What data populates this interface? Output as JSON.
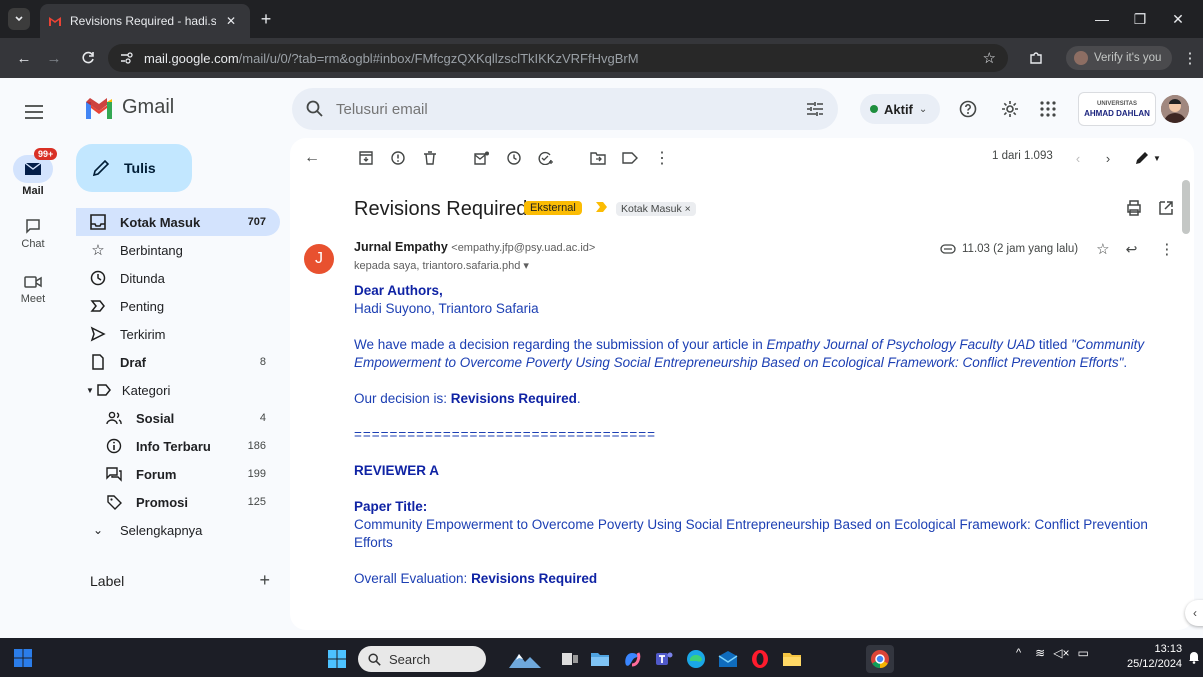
{
  "browser": {
    "tab_title": "Revisions Required - hadi.suyon",
    "url_host": "mail.google.com",
    "url_path": "/mail/u/0/?tab=rm&ogbl#inbox/FMfcgzQXKqllzsclTkIKKzVRFfHvgBrM",
    "verify_label": "Verify it's you"
  },
  "gmail": {
    "logo_text": "Gmail",
    "search_placeholder": "Telusuri email",
    "status_label": "Aktif",
    "org_line1": "UNIVERSITAS",
    "org_line2": "AHMAD DAHLAN"
  },
  "rail": {
    "mail_label": "Mail",
    "mail_badge": "99+",
    "chat_label": "Chat",
    "meet_label": "Meet"
  },
  "compose_label": "Tulis",
  "nav": [
    {
      "label": "Kotak Masuk",
      "count": "707",
      "icon": "inbox-icon"
    },
    {
      "label": "Berbintang",
      "count": "",
      "icon": "star-icon"
    },
    {
      "label": "Ditunda",
      "count": "",
      "icon": "clock-icon"
    },
    {
      "label": "Penting",
      "count": "",
      "icon": "important-icon"
    },
    {
      "label": "Terkirim",
      "count": "",
      "icon": "send-icon"
    },
    {
      "label": "Draf",
      "count": "8",
      "icon": "draft-icon"
    },
    {
      "label": "Kategori",
      "count": "",
      "icon": "label-icon"
    },
    {
      "label": "Sosial",
      "count": "4",
      "icon": "people-icon"
    },
    {
      "label": "Info Terbaru",
      "count": "186",
      "icon": "info-icon"
    },
    {
      "label": "Forum",
      "count": "199",
      "icon": "forum-icon"
    },
    {
      "label": "Promosi",
      "count": "125",
      "icon": "tag-icon"
    },
    {
      "label": "Selengkapnya",
      "count": "",
      "icon": "chevron-down-icon"
    }
  ],
  "label_header": "Label",
  "pager_text": "1 dari 1.093",
  "email": {
    "subject": "Revisions Required",
    "external_badge": "Eksternal",
    "inbox_chip": "Kotak Masuk ×",
    "sender_initial": "J",
    "sender_name": "Jurnal Empathy",
    "sender_email": "<empathy.jfp@psy.uad.ac.id>",
    "recipients": "kepada saya, triantoro.safaria.phd ▾",
    "time": "11.03 (2 jam yang lalu)",
    "greeting": "Dear Authors,",
    "authors": "Hadi Suyono, Triantoro Safaria",
    "p1_a": "We have made a decision regarding the submission of your article in ",
    "p1_journal": "Empathy Journal of Psychology Faculty UAD",
    "p1_b": " titled ",
    "p1_title": "\"Community Empowerment to Overcome Poverty Using Social Entrepreneurship Based on Ecological Framework: Conflict Prevention Efforts\"",
    "p1_c": ".",
    "decision_prefix": "Our decision is: ",
    "decision": "Revisions Required",
    "decision_end": ".",
    "separator": "==================================",
    "reviewer": "REVIEWER A",
    "paper_title_label": "Paper Title:",
    "paper_title": "Community Empowerment to Overcome Poverty Using Social Entrepreneurship Based on Ecological Framework: Conflict Prevention Efforts",
    "overall_prefix": "Overall Evaluation: ",
    "overall": "Revisions Required"
  },
  "taskbar": {
    "search_placeholder": "Search",
    "time": "13:13",
    "date": "25/12/2024"
  },
  "colors": {
    "accent": "#0b57d0",
    "selected_nav": "#d3e3fd",
    "compose": "#c2e7ff",
    "external_badge": "#fbbc04",
    "email_text": "#1c3fb3"
  }
}
